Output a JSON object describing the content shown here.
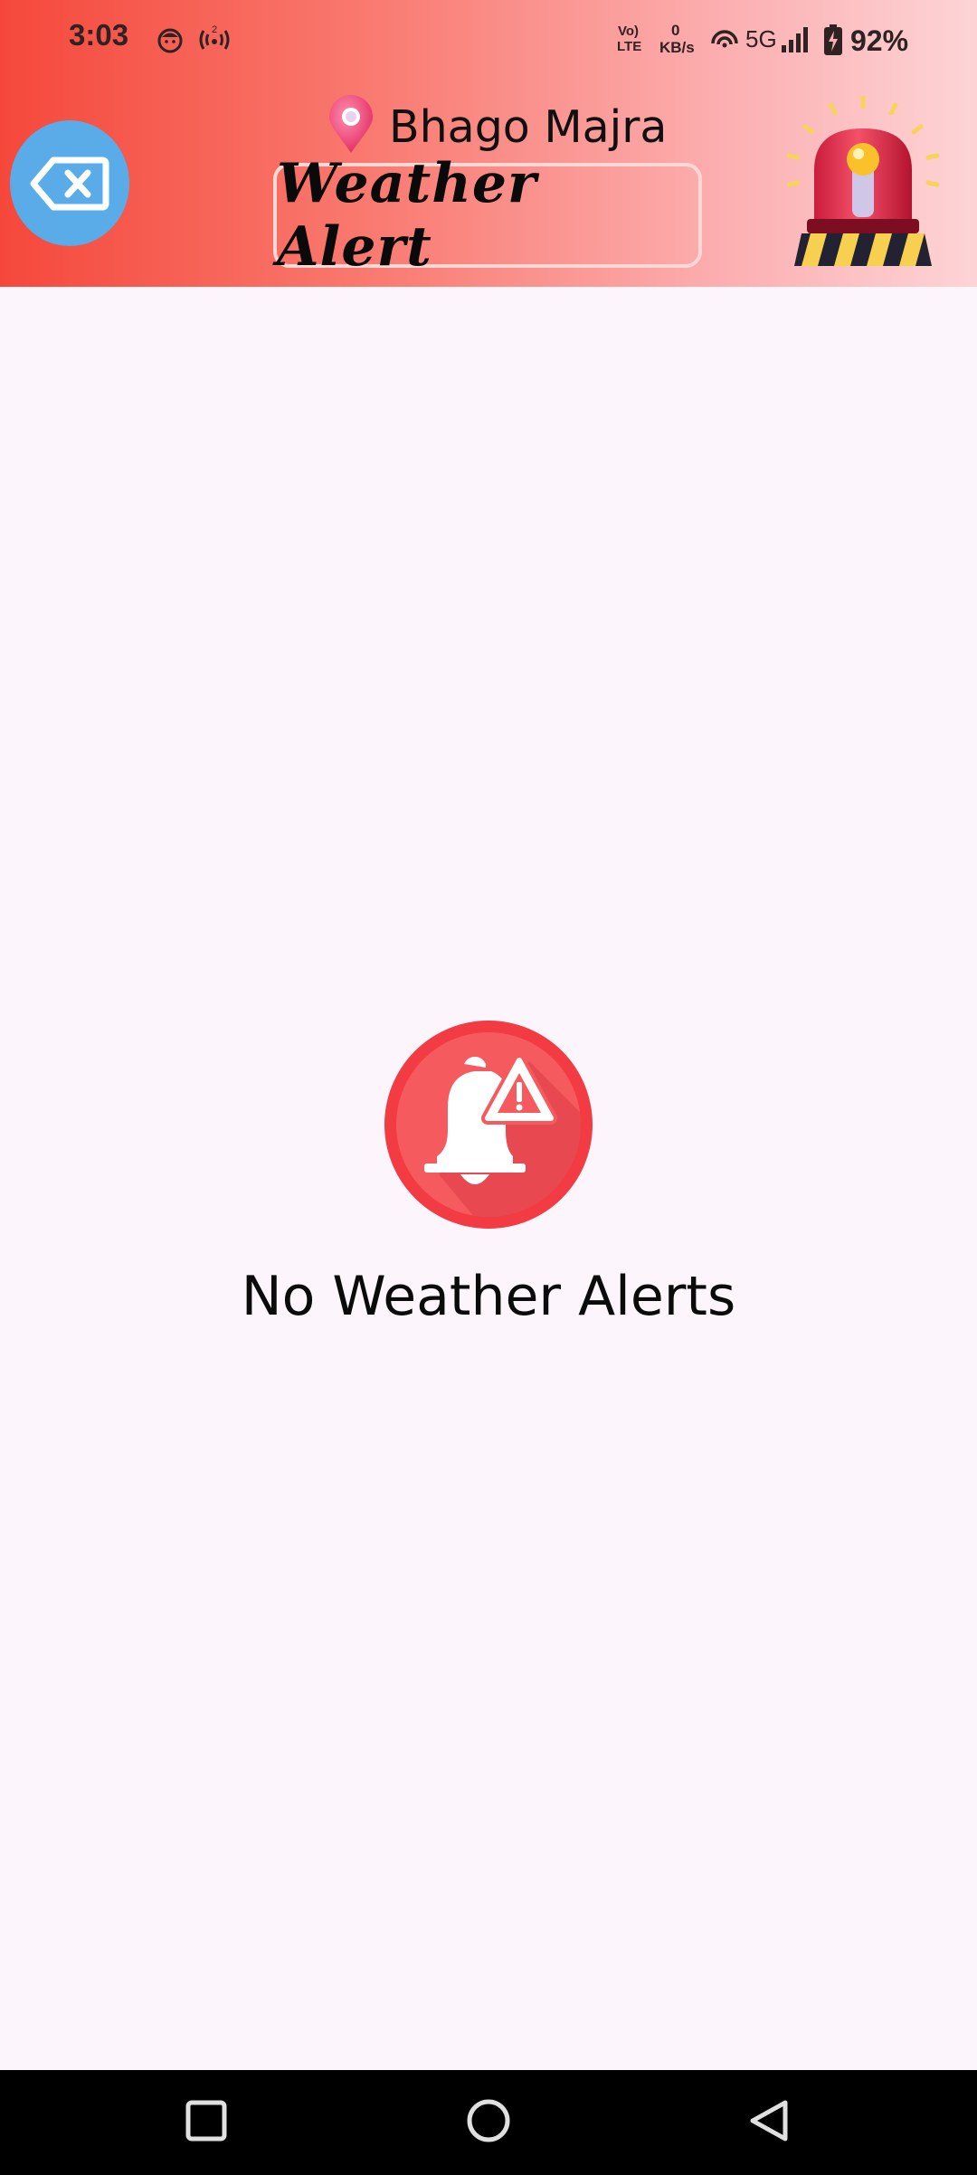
{
  "status_bar": {
    "time": "3:03",
    "network_top": "Vo)",
    "network_bottom": "LTE",
    "speed_value": "0",
    "speed_unit": "KB/s",
    "network_type": "5G",
    "battery": "92%",
    "icons": [
      "face-notification-icon",
      "hotspot-icon",
      "wifi-calling-icon",
      "signal-icon",
      "battery-charging-icon"
    ]
  },
  "header": {
    "location": "Bhago Majra",
    "title": "Weather Alert",
    "location_icon": "map-pin-icon",
    "back_icon": "backspace-close-icon",
    "siren_icon": "siren-icon",
    "colors": {
      "gradient_start": "#f5483b",
      "gradient_end": "#fdd4d6",
      "back_button": "#5aace8"
    }
  },
  "main": {
    "empty_message": "No Weather Alerts",
    "empty_icon": "bell-alert-icon",
    "alert_color": "#f5424a"
  },
  "nav": {
    "recent_icon": "square-icon",
    "home_icon": "circle-icon",
    "back_icon": "triangle-back-icon"
  }
}
